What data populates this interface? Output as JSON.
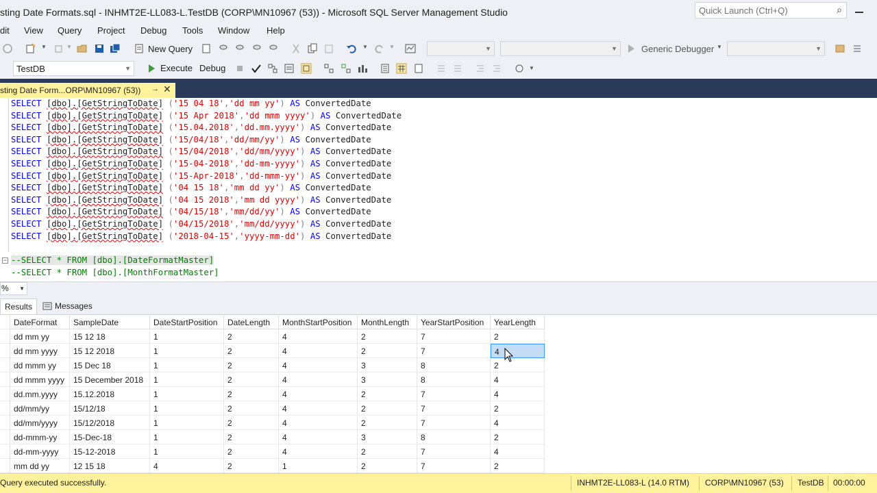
{
  "window": {
    "title": "sting Date Formats.sql - INHMT2E-LL083-L.TestDB (CORP\\MN10967 (53)) - Microsoft SQL Server Management Studio",
    "quick_launch_placeholder": "Quick Launch (Ctrl+Q)"
  },
  "menu": [
    "dit",
    "View",
    "Query",
    "Project",
    "Debug",
    "Tools",
    "Window",
    "Help"
  ],
  "toolbar1": {
    "new_query": "New Query",
    "debugger": "Generic Debugger"
  },
  "toolbar2": {
    "database": "TestDB",
    "execute": "Execute",
    "debug": "Debug"
  },
  "doc_tab": {
    "label": "sting Date Form...ORP\\MN10967 (53))"
  },
  "editor": {
    "lines": [
      {
        "date": "'15 04 18'",
        "fmt": "'dd mm yy'"
      },
      {
        "date": "'15 Apr 2018'",
        "fmt": "'dd mmm yyyy'"
      },
      {
        "date": "'15.04.2018'",
        "fmt": "'dd.mm.yyyy'"
      },
      {
        "date": "'15/04/18'",
        "fmt": "'dd/mm/yy'"
      },
      {
        "date": "'15/04/2018'",
        "fmt": "'dd/mm/yyyy'"
      },
      {
        "date": "'15-04-2018'",
        "fmt": "'dd-mm-yyyy'"
      },
      {
        "date": "'15-Apr-2018'",
        "fmt": "'dd-mmm-yy'"
      },
      {
        "date": "'04 15 18'",
        "fmt": "'mm dd yy'"
      },
      {
        "date": "'04 15 2018'",
        "fmt": "'mm dd yyyy'"
      },
      {
        "date": "'04/15/18'",
        "fmt": "'mm/dd/yy'"
      },
      {
        "date": "'04/15/2018'",
        "fmt": "'mm/dd/yyyy'"
      },
      {
        "date": "'2018-04-15'",
        "fmt": "'yyyy-mm-dd'"
      }
    ],
    "select_kw": "SELECT",
    "function": "[dbo].[GetStringToDate]",
    "as_kw": "AS",
    "alias": "ConvertedDate",
    "comments": [
      "--SELECT * FROM [dbo].[DateFormatMaster]",
      "--SELECT * FROM [dbo].[MonthFormatMaster]"
    ]
  },
  "zoom": "%",
  "result_tabs": {
    "results": "Results",
    "messages": "Messages"
  },
  "grid": {
    "columns": [
      "DateFormat",
      "SampleDate",
      "DateStartPosition",
      "DateLength",
      "MonthStartPosition",
      "MonthLength",
      "YearStartPosition",
      "YearLength"
    ],
    "rows": [
      [
        "dd mm yy",
        "15 12 18",
        "1",
        "2",
        "4",
        "2",
        "7",
        "2"
      ],
      [
        "dd mm yyyy",
        "15 12 2018",
        "1",
        "2",
        "4",
        "2",
        "7",
        "4"
      ],
      [
        "dd mmm yy",
        "15 Dec 18",
        "1",
        "2",
        "4",
        "3",
        "8",
        "2"
      ],
      [
        "dd mmm yyyy",
        "15 December 2018",
        "1",
        "2",
        "4",
        "3",
        "8",
        "4"
      ],
      [
        "dd.mm.yyyy",
        "15.12.2018",
        "1",
        "2",
        "4",
        "2",
        "7",
        "4"
      ],
      [
        "dd/mm/yy",
        "15/12/18",
        "1",
        "2",
        "4",
        "2",
        "7",
        "2"
      ],
      [
        "dd/mm/yyyy",
        "15/12/2018",
        "1",
        "2",
        "4",
        "2",
        "7",
        "4"
      ],
      [
        "dd-mmm-yy",
        "15-Dec-18",
        "1",
        "2",
        "4",
        "3",
        "8",
        "2"
      ],
      [
        "dd-mm-yyyy",
        "15-12-2018",
        "1",
        "2",
        "4",
        "2",
        "7",
        "4"
      ],
      [
        "mm dd yy",
        "12 15 18",
        "4",
        "2",
        "1",
        "2",
        "7",
        "2"
      ]
    ]
  },
  "status": {
    "message": "Query executed successfully.",
    "server": "INHMT2E-LL083-L (14.0 RTM)",
    "user": "CORP\\MN10967 (53)",
    "database": "TestDB",
    "elapsed": "00:00:00"
  },
  "colors": {
    "status_bar": "#fff29d",
    "tab_strip": "#2b3a58",
    "keyword": "#0000ff",
    "string": "#e00000",
    "comment": "#008000",
    "selection": "#c5dcf6"
  }
}
